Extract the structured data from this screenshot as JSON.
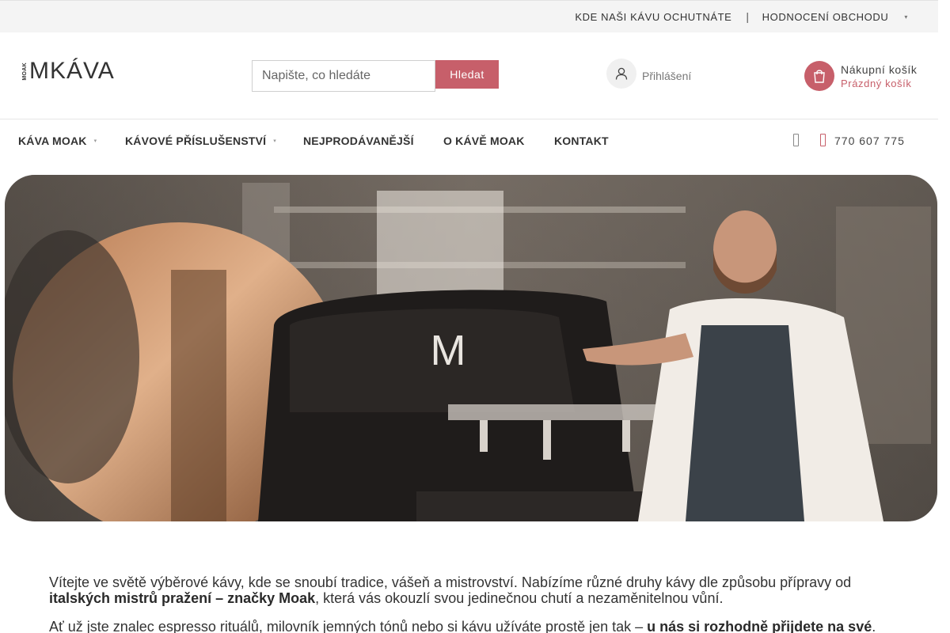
{
  "topbar": {
    "link1": "KDE NAŠI KÁVU OCHUTNÁTE",
    "separator": "|",
    "link2": "HODNOCENÍ OBCHODU"
  },
  "header": {
    "logo_small": "MOAK",
    "logo_text": "MKÁVA",
    "search_placeholder": "Napište, co hledáte",
    "search_button": "Hledat",
    "login_label": "Přihlášení",
    "cart_title": "Nákupní košík",
    "cart_status": "Prázdný košík"
  },
  "nav": {
    "items": [
      {
        "label": "KÁVA MOAK"
      },
      {
        "label": "KÁVOVÉ PŘÍSLUŠENSTVÍ"
      },
      {
        "label": "NEJPRODÁVANĚJŠÍ"
      },
      {
        "label": "O KÁVĚ MOAK"
      },
      {
        "label": "KONTAKT"
      }
    ],
    "phone": "770 607 775"
  },
  "hero": {
    "machine_letter": "M"
  },
  "intro": {
    "p1_a": "Vítejte ve světě výběrové kávy, kde se snoubí tradice, vášeň a mistrovství. Nabízíme různé druhy kávy dle způsobu přípravy od ",
    "p1_b": "italských mistrů pražení – značky Moak",
    "p1_c": ", která vás okouzlí svou jedinečnou chutí a nezaměnitelnou vůní.",
    "p2_a": "Ať už jste znalec espresso rituálů, milovník jemných tónů nebo si kávu užíváte prostě jen tak – ",
    "p2_b": "u nás si rozhodně přijdete na své",
    "p2_c": "."
  },
  "colors": {
    "accent": "#c75f6a",
    "topbar_bg": "#f4f4f4"
  },
  "icons": [
    "user-icon",
    "shopping-bag-icon",
    "chevron-down-icon",
    "facebook-icon",
    "phone-icon"
  ]
}
